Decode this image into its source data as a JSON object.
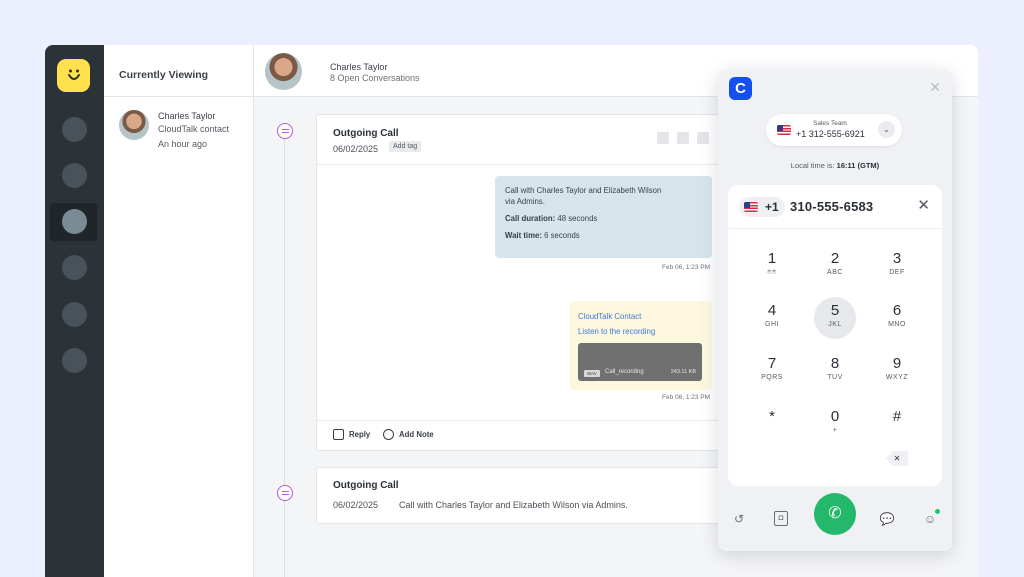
{
  "sidebar": {
    "logo_icon": "smile-face-icon"
  },
  "viewing": {
    "title": "Currently Viewing",
    "name": "Charles Taylor",
    "subtitle": "CloudTalk contact",
    "time": "An hour ago"
  },
  "header": {
    "name": "Charles Taylor",
    "subtitle": "8 Open Conversations"
  },
  "card1": {
    "title": "Outgoing Call",
    "date": "06/02/2025",
    "tag_button": "Add tag",
    "bubble1": {
      "line1": "Call with Charles Taylor and Elizabeth Wilson",
      "line2": "via Admins.",
      "duration_label": "Call duration:",
      "duration_value": "48 seconds",
      "wait_label": "Wait time:",
      "wait_value": "6 seconds",
      "timestamp": "Feb 06, 1:23 PM"
    },
    "bubble2": {
      "contact_link": "CloudTalk Contact",
      "recording_link": "Listen to the recording",
      "badge": "WAV",
      "file_name": "Call_recording",
      "file_size": "243.11 KB",
      "timestamp": "Feb 06, 1:23 PM"
    },
    "reply_label": "Reply",
    "note_label": "Add Note"
  },
  "card2": {
    "title": "Outgoing Call",
    "date": "06/02/2025",
    "text": "Call with Charles Taylor and Elizabeth Wilson via Admins."
  },
  "dialer": {
    "logo_letter": "C",
    "team_label": "Sales Team",
    "team_number": "+1 312-555-6921",
    "local_time_label": "Local time is:",
    "local_time_value": "16:11 (GTM)",
    "country_code": "+1",
    "phone_number": "310-555-6583",
    "keys": [
      {
        "digit": "1",
        "letters": ""
      },
      {
        "digit": "2",
        "letters": "ABC"
      },
      {
        "digit": "3",
        "letters": "DEF"
      },
      {
        "digit": "4",
        "letters": "GHI"
      },
      {
        "digit": "5",
        "letters": "JKL"
      },
      {
        "digit": "6",
        "letters": "MNO"
      },
      {
        "digit": "7",
        "letters": "PQRS"
      },
      {
        "digit": "8",
        "letters": "TUV"
      },
      {
        "digit": "9",
        "letters": "WXYZ"
      },
      {
        "digit": "*",
        "letters": ""
      },
      {
        "digit": "0",
        "letters": "+"
      },
      {
        "digit": "#",
        "letters": ""
      }
    ],
    "colors": {
      "brand": "#1450f0",
      "call": "#24b86a"
    }
  }
}
